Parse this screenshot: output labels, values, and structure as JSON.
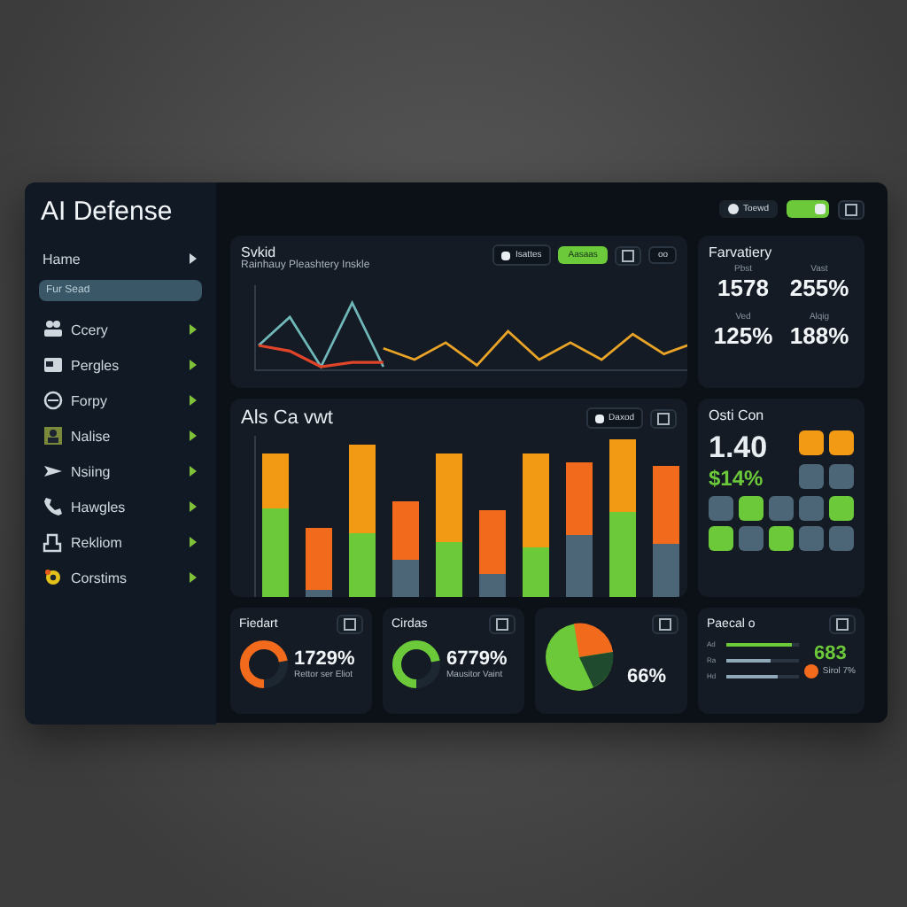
{
  "sidebar": {
    "title": "AI Defense",
    "home": {
      "label": "Hame"
    },
    "search": {
      "placeholder": "Fur Sead"
    },
    "items": [
      {
        "label": "Ccery"
      },
      {
        "label": "Pergles"
      },
      {
        "label": "Forpy"
      },
      {
        "label": "Nalise"
      },
      {
        "label": "Nsiing"
      },
      {
        "label": "Hawgles"
      },
      {
        "label": "Rekliom"
      },
      {
        "label": "Corstims"
      }
    ]
  },
  "header": {
    "chip": "Toewd",
    "toggle": {
      "on": true
    }
  },
  "line_panel": {
    "title": "Svkid",
    "subtitle": "Rainhauy Pleashtery Inskle",
    "chip": "Isattes",
    "button": "Aasaas",
    "menu": "oo"
  },
  "stats_panel": {
    "title": "Farvatiery",
    "stats": [
      {
        "label": "Pbst",
        "value": "1578"
      },
      {
        "label": "Vast",
        "value": "255%"
      },
      {
        "label": "Ved",
        "value": "125%"
      },
      {
        "label": "Alqig",
        "value": "188%"
      }
    ]
  },
  "bar_panel": {
    "title": "Als Ca vwt",
    "chip": "Daxod"
  },
  "tiles_panel": {
    "title": "Osti Con",
    "value": "1.40",
    "change": "$14%",
    "tiles": [
      {
        "color": "#f39a14"
      },
      {
        "color": "#f39a14"
      },
      {
        "color": "#4c6678"
      },
      {
        "color": "#4c6678"
      },
      {
        "color": "#4c6678"
      },
      {
        "color": "#6cc93a"
      },
      {
        "color": "#4c6678"
      },
      {
        "color": "#4c6678"
      },
      {
        "color": "#6cc93a"
      },
      {
        "color": "#6cc93a"
      },
      {
        "color": "#4c6678"
      },
      {
        "color": "#6cc93a"
      },
      {
        "color": "#4c6678"
      },
      {
        "color": "#4c6678"
      }
    ]
  },
  "cards": [
    {
      "kind": "ring",
      "title": "Fiedart",
      "value": "1729%",
      "caption": "Rettor ser Eliot",
      "color": "#f26a1b"
    },
    {
      "kind": "ring",
      "title": "Cirdas",
      "value": "6779%",
      "caption": "Mausitor Vaint",
      "color": "#6cc93a"
    },
    {
      "kind": "pie",
      "value": "66%"
    },
    {
      "kind": "lines",
      "title": "Paecal o",
      "lines": [
        {
          "label": "Ad",
          "level": 0.9
        },
        {
          "label": "Ra",
          "level": 0.6
        },
        {
          "label": "Hd",
          "level": 0.7
        }
      ],
      "value": "683",
      "note": "Sirol 7%"
    }
  ]
}
